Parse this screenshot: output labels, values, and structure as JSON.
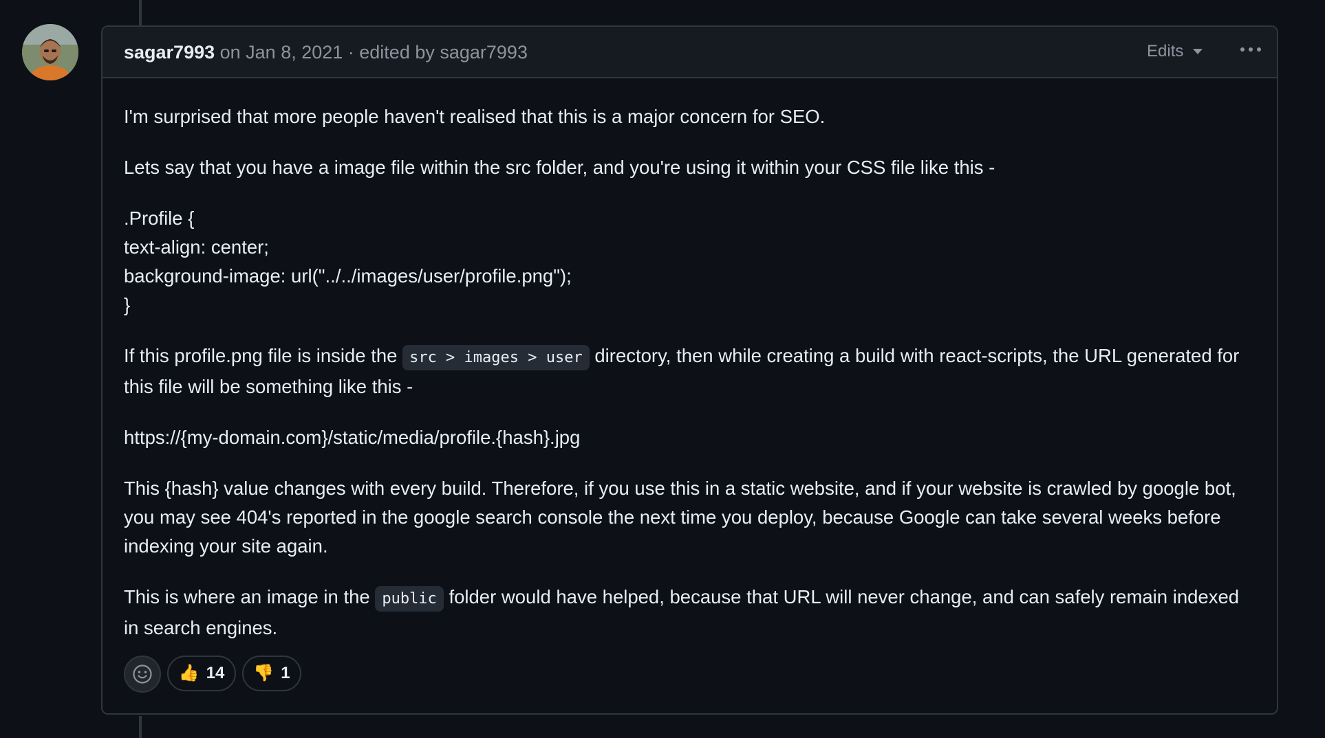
{
  "comment": {
    "author": "sagar7993",
    "meta": " on Jan 8, 2021 · edited by sagar7993",
    "edits_label": "Edits",
    "paragraphs": {
      "p1": "I'm surprised that more people haven't realised that this is a major concern for SEO.",
      "p2": "Lets say that you have a image file within the src folder, and you're using it within your CSS file like this -",
      "css_lines": [
        ".Profile {",
        "text-align: center;",
        "background-image: url(\"../../images/user/profile.png\");",
        "}"
      ],
      "p4_before": "If this profile.png file is inside the ",
      "p4_code": "src > images > user",
      "p4_after": " directory, then while creating a build with react-scripts, the URL generated for this file will be something like this -",
      "p5": "https://{my-domain.com}/static/media/profile.{hash}.jpg",
      "p6": "This {hash} value changes with every build. Therefore, if you use this in a static website, and if your website is crawled by google bot, you may see 404's reported in the google search console the next time you deploy, because Google can take several weeks before indexing your site again.",
      "p7_before": "This is where an image in the ",
      "p7_code": "public",
      "p7_after": " folder would have helped, because that URL will never change, and can safely remain indexed in search engines."
    },
    "reactions": {
      "add_icon": "smiley-icon",
      "thumbs_up": {
        "emoji": "👍",
        "count": "14"
      },
      "thumbs_down": {
        "emoji": "👎",
        "count": "1"
      }
    }
  },
  "colors": {
    "background": "#0d1117",
    "header_bg": "#161b22",
    "border": "#30363d",
    "text": "#e6edf3",
    "muted": "#8b949e"
  }
}
